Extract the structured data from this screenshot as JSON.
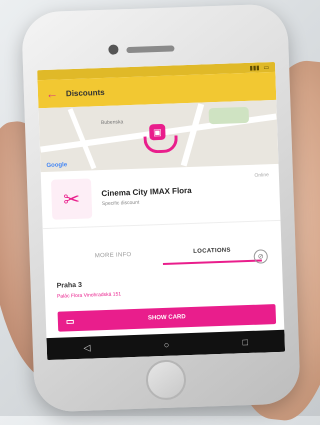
{
  "statusbar": {
    "time": ""
  },
  "appbar": {
    "back_icon": "arrow-left-icon",
    "title": "Discounts"
  },
  "map": {
    "street_label": "Bubenska",
    "google_label": "Google"
  },
  "venue": {
    "name": "Cinema City IMAX Flora",
    "subtitle": "Specific discount",
    "mode": "Online"
  },
  "tabs": [
    {
      "label": "MORE INFO",
      "active": false
    },
    {
      "label": "LOCATIONS",
      "active": true
    }
  ],
  "locations": {
    "city": "Praha 3",
    "address": "Palác Flora Vinohradská 151"
  },
  "cta": {
    "label": "SHOW CARD"
  },
  "colors": {
    "accent": "#e91e8c",
    "appbar": "#f2c832"
  }
}
